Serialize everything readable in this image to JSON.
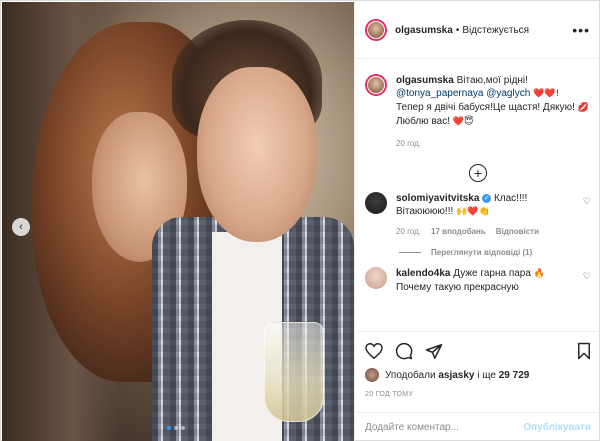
{
  "post": {
    "username": "olgasumska",
    "separator": "•",
    "follow_label": "Відстежується",
    "more_label": "•••"
  },
  "caption": {
    "username": "olgasumska",
    "text_1": "Вітаю,мої рідні!",
    "mention_1": "@tonya_papernaya",
    "mention_2": "@yaglych",
    "emoji_1": "❤️❤️!",
    "text_2": "Тепер я двічі бабуся!Це щастя! Дякую!",
    "emoji_2": "💋",
    "text_3": "Люблю вас!",
    "emoji_3": "❤️😇",
    "time": "20 год."
  },
  "comments": [
    {
      "username": "solomiyavitvitska",
      "text": "Клас!!!! Вітаюююю!!!",
      "emoji": "🙌❤️👏",
      "time": "20 год.",
      "likes": "17 вподобань",
      "reply": "Відповісти",
      "view_replies": "Переглянути відповіді (1)"
    },
    {
      "username": "kalendo4ka",
      "text": "Дуже гарна пара",
      "emoji": "🔥",
      "text_2": "Почему такую прекрасную"
    }
  ],
  "actions": {
    "liked_by_prefix": "Уподобали",
    "liked_by_user": "asjasky",
    "liked_by_and": "і ще",
    "liked_by_count": "29 729",
    "post_time": "20 ГОД ТОМУ"
  },
  "add_comment": {
    "placeholder": "Додайте коментар...",
    "publish_label": "Опублікувати"
  },
  "icons": {
    "heart": "heart-icon",
    "comment": "comment-icon",
    "share": "share-icon",
    "bookmark": "bookmark-icon",
    "add": "plus-circle-icon",
    "prev": "chevron-left-icon"
  }
}
